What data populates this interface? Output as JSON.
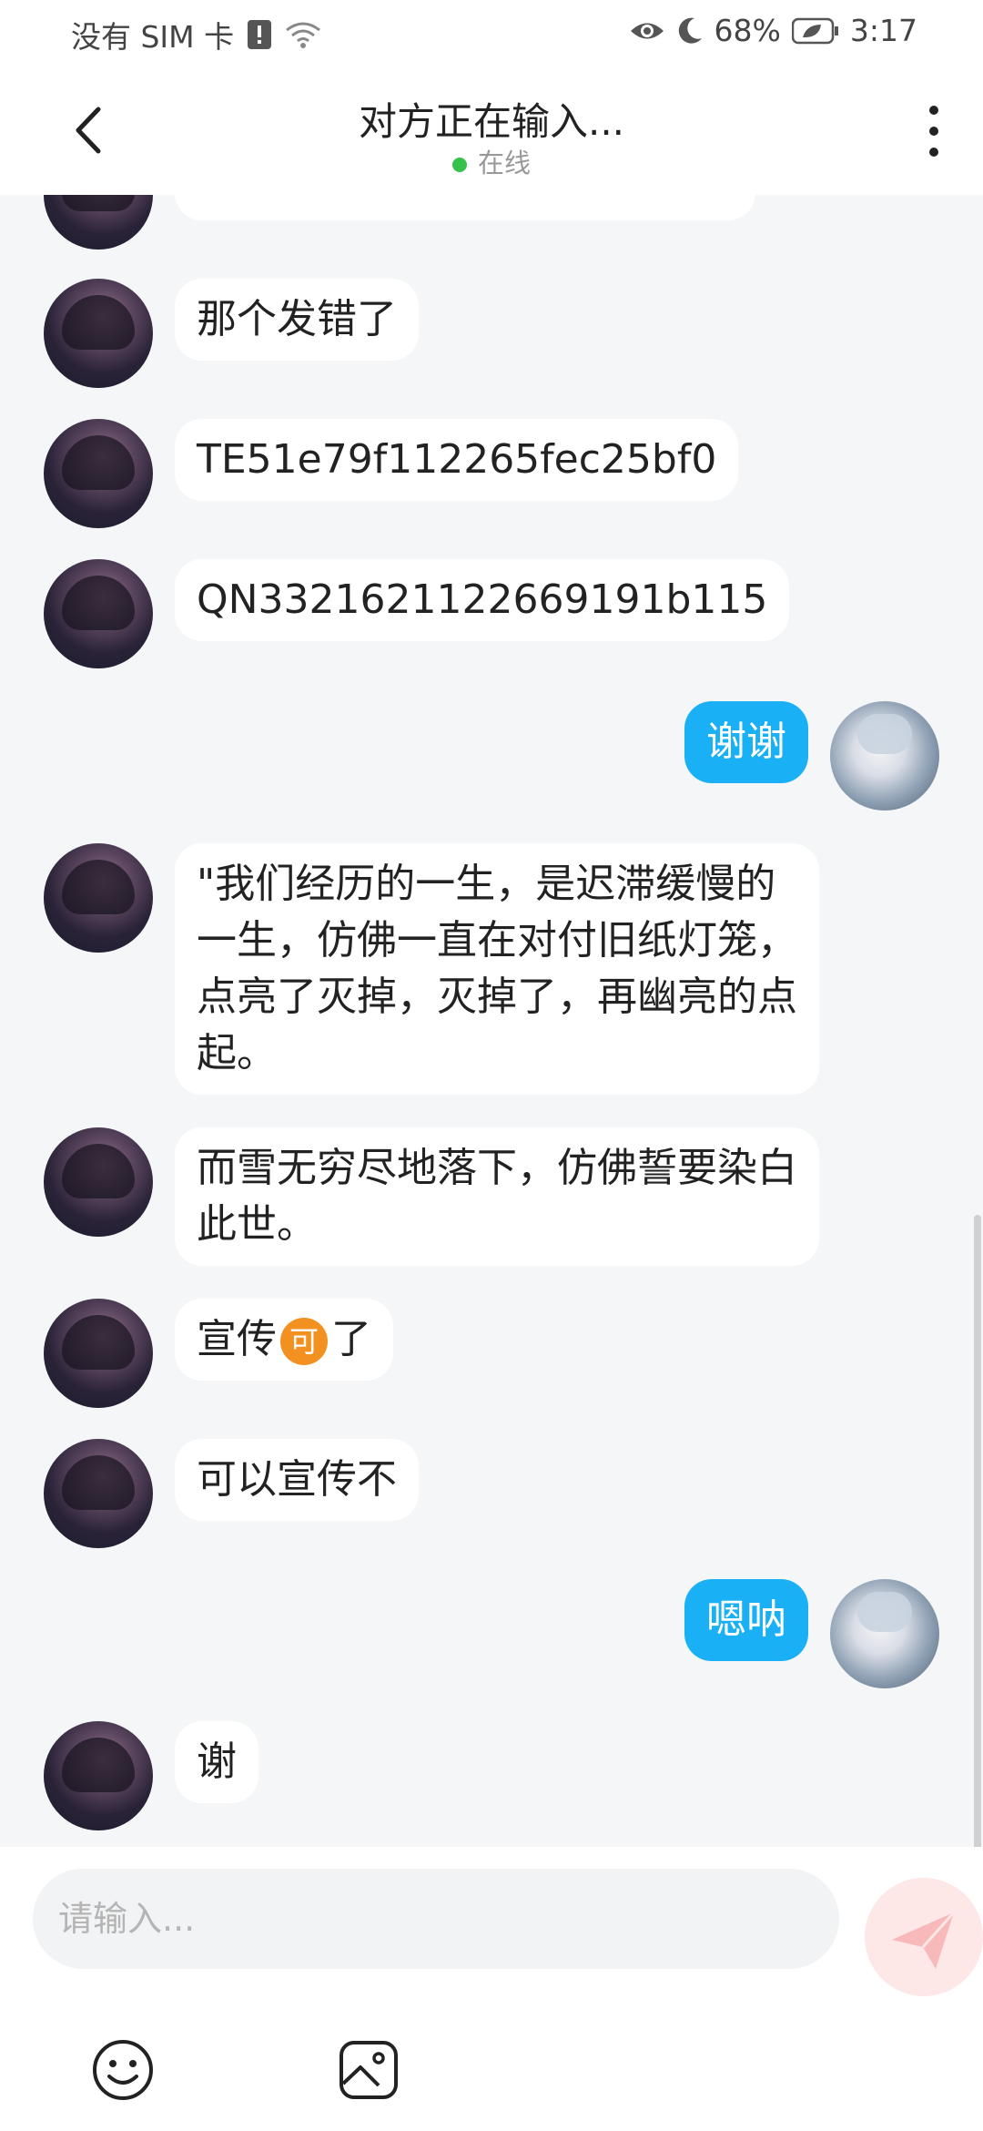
{
  "status_bar": {
    "carrier": "没有 SIM 卡",
    "battery": "68%",
    "time": "3:17"
  },
  "header": {
    "title": "对方正在输入...",
    "presence": "在线"
  },
  "messages": [
    {
      "side": "left",
      "text": "那个发错了"
    },
    {
      "side": "left",
      "text": "TE51e79f112265fec25bf0"
    },
    {
      "side": "left",
      "text": "QN3321621122669191b115"
    },
    {
      "side": "right",
      "text": "谢谢"
    },
    {
      "side": "left",
      "text": "\"我们经历的一生，是迟滞缓慢的一生，仿佛一直在对付旧纸灯笼，点亮了灭掉，灭掉了，再幽亮的点起。"
    },
    {
      "side": "left",
      "text": "而雪无穷尽地落下，仿佛誓要染白此世。"
    },
    {
      "side": "left",
      "text_before": "宣传",
      "emoji": "可",
      "text_after": "了"
    },
    {
      "side": "left",
      "text": "可以宣传不"
    },
    {
      "side": "right",
      "text": "嗯呐"
    },
    {
      "side": "left",
      "text": "谢"
    }
  ],
  "composer": {
    "placeholder": "请输入..."
  },
  "colors": {
    "outgoing_bubble": "#1ab0f5",
    "incoming_bubble": "#ffffff",
    "online_dot": "#35c24b",
    "send_button": "#fde7e7"
  }
}
